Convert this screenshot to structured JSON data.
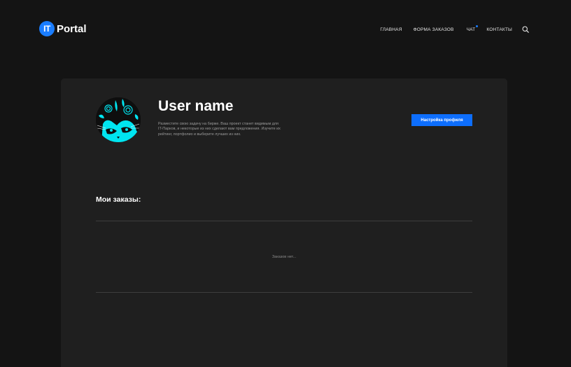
{
  "header": {
    "logo_badge": "IT",
    "logo_text": "Portal",
    "nav": {
      "home": "ГЛАВНАЯ",
      "orders_form": "ФОРМА ЗАКАЗОВ",
      "chat": "ЧАТ",
      "contacts": "КОНТАКТЫ"
    },
    "chat_has_unread": true,
    "icons": {
      "search": "search-icon"
    }
  },
  "profile": {
    "avatar": "avatar-image",
    "name": "User name",
    "description": "Разместите свою задачу на бирже. Ваш проект станет видимым для IT-Парков, и некоторые из них сделают вам предложения. Изучите их рейтинг, портфолио и выберите лучших из них.",
    "settings_button": "Настройка профиля"
  },
  "orders": {
    "title": "Мои заказы:",
    "empty_text": "Заказов нет..."
  },
  "colors": {
    "background": "#141414",
    "card": "#1f1f1f",
    "accent": "#0d6efd",
    "avatar_cyan": "#00e5f0"
  }
}
